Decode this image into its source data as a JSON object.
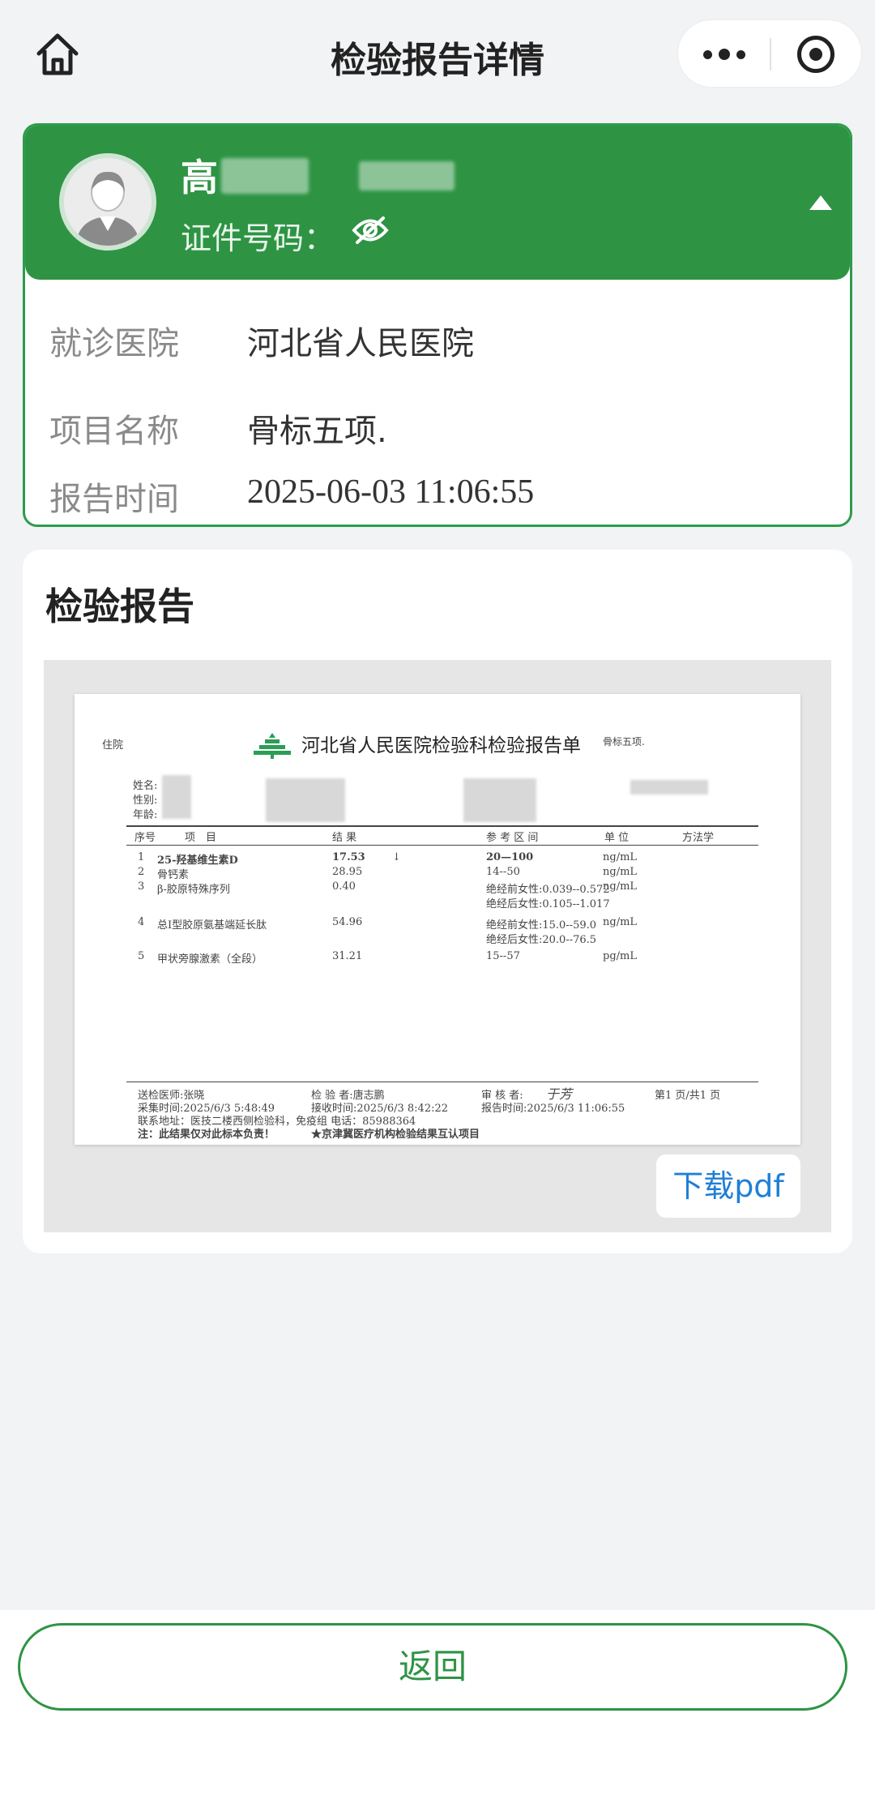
{
  "nav": {
    "title": "检验报告详情"
  },
  "patient": {
    "name_visible": "高",
    "id_label": "证件号码：",
    "hospital_label": "就诊医院",
    "hospital_value": "河北省人民医院",
    "project_label": "项目名称",
    "project_value": "骨标五项.",
    "time_label": "报告时间",
    "time_value": "2025-06-03 11:06:55"
  },
  "report": {
    "section_title": "检验报告",
    "download_label": "下载pdf",
    "paper": {
      "inpatient": "住院",
      "hospital_title": "河北省人民医院检验科检验报告单",
      "specimen": "骨标五项.",
      "name_label": "姓名:",
      "sex_label": "性别:",
      "age_label": "年龄:",
      "headers": [
        "序号",
        "项　目",
        "结 果",
        "参 考 区 间",
        "单 位",
        "方法学"
      ],
      "rows": [
        {
          "no": "1",
          "item": "25-羟基维生素D",
          "result": "17.53",
          "flag": "↓",
          "range": "20—100",
          "unit": "ng/mL"
        },
        {
          "no": "2",
          "item": "骨钙素",
          "result": "28.95",
          "flag": "",
          "range": "14--50",
          "unit": "ng/mL"
        },
        {
          "no": "3",
          "item": "β-胶原特殊序列",
          "result": "0.40",
          "flag": "",
          "range": "绝经前女性:0.039--0.572",
          "range2": "绝经后女性:0.105--1.017",
          "unit": "ng/mL"
        },
        {
          "no": "4",
          "item": "总I型胶原氨基端延长肽",
          "result": "54.96",
          "flag": "",
          "range": "绝经前女性:15.0--59.0",
          "range2": "绝经后女性:20.0--76.5",
          "unit": "ng/mL"
        },
        {
          "no": "5",
          "item": "甲状旁腺激素（全段）",
          "result": "31.21",
          "flag": "",
          "range": "15--57",
          "unit": "pg/mL"
        }
      ],
      "footer": {
        "doctor": "送检医师:张晓",
        "inspector": "检 验 者:唐志鹏",
        "reviewer": "审 核 者:",
        "signature": "于芳",
        "page": "第1 页/共1 页",
        "collect_time": "采集时间:2025/6/3 5:48:49",
        "receive_time": "接收时间:2025/6/3 8:42:22",
        "report_time": "报告时间:2025/6/3 11:06:55",
        "address": "联系地址：医技二楼西侧检验科，免疫组 电话：85988364",
        "note": "注：此结果仅对此标本负责！",
        "mutual": "★京津冀医疗机构检验结果互认项目"
      }
    }
  },
  "footer": {
    "back_label": "返回"
  },
  "colors": {
    "primary_green": "#2e9444",
    "link_blue": "#1f7fd6",
    "background": "#f2f3f5"
  },
  "icons": [
    "home-icon",
    "more-icon",
    "close-circle-icon",
    "eye-off-icon",
    "collapse-caret-icon",
    "avatar-icon",
    "hospital-logo-icon"
  ]
}
